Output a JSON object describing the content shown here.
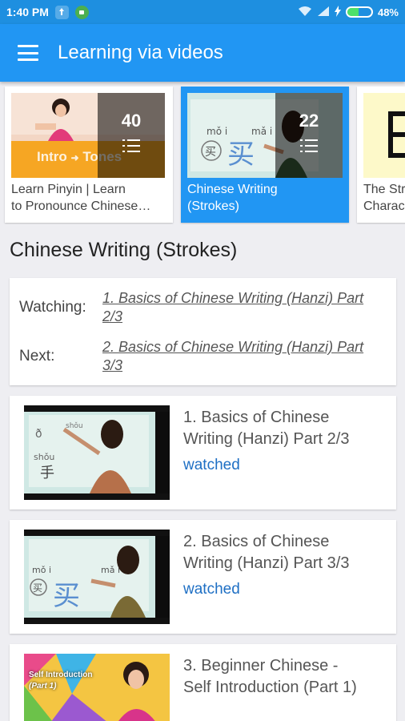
{
  "status_bar": {
    "time": "1:40 PM",
    "battery_text": "48%",
    "battery_level": 0.48,
    "icons": [
      "app-notification-icon",
      "android-icon",
      "wifi-icon",
      "signal-icon",
      "charging-icon",
      "battery-icon"
    ]
  },
  "app_bar": {
    "title": "Learning via videos",
    "menu_icon": "hamburger-menu-icon"
  },
  "categories": [
    {
      "line1": "Learn Pinyin | Learn",
      "line2": "to Pronounce Chinese…",
      "count": "40",
      "thumb_text_1": "Intro",
      "thumb_text_2": "Tones"
    },
    {
      "line1": "Chinese Writing",
      "line2": "(Strokes)",
      "count": "22",
      "selected": true
    },
    {
      "line1": "The Str",
      "line2": "Charac"
    }
  ],
  "section": {
    "title": "Chinese Writing (Strokes)"
  },
  "progress": {
    "watching_label": "Watching:",
    "watching_line1": "1. Basics of Chinese Writing (Hanzi) Part",
    "watching_line2": "2/3",
    "next_label": "Next:",
    "next_line1": "2. Basics of Chinese Writing (Hanzi) Part",
    "next_line2": "3/3"
  },
  "videos": [
    {
      "title_line1": "1. Basics of Chinese",
      "title_line2": "Writing (Hanzi) Part 2/3",
      "status": "watched"
    },
    {
      "title_line1": "2. Basics of Chinese",
      "title_line2": "Writing (Hanzi) Part 3/3",
      "status": "watched"
    },
    {
      "title_line1": "3. Beginner Chinese -",
      "title_line2": "Self Introduction (Part 1)",
      "status": "",
      "thumb_text_1": "Self Introduction",
      "thumb_text_2": "(Part 1)"
    }
  ],
  "colors": {
    "primary": "#2196f3",
    "status_bar": "#1e8fe0",
    "background": "#eeeef2",
    "watched": "#1e6fc4"
  }
}
